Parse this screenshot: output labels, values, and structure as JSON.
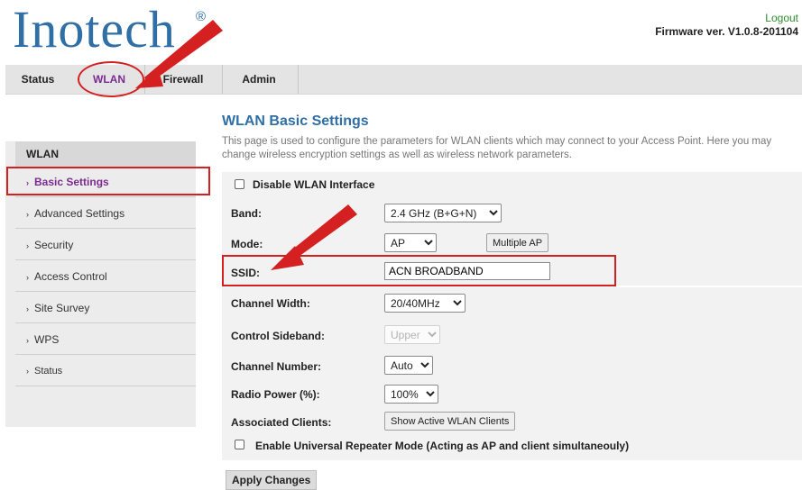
{
  "header": {
    "logo_text": "Inotech",
    "registered_mark": "®",
    "logout_label": "Logout",
    "firmware": "Firmware ver. V1.0.8-201104"
  },
  "nav": {
    "tabs": [
      {
        "label": "Status"
      },
      {
        "label": "WLAN"
      },
      {
        "label": "Firewall"
      },
      {
        "label": "Admin"
      }
    ],
    "active_color": "#7b2b8f"
  },
  "sidebar": {
    "heading": "WLAN",
    "items": [
      {
        "label": "Basic Settings"
      },
      {
        "label": "Advanced Settings"
      },
      {
        "label": "Security"
      },
      {
        "label": "Access Control"
      },
      {
        "label": "Site Survey"
      },
      {
        "label": "WPS"
      },
      {
        "label": "Status"
      }
    ],
    "chevron": "›"
  },
  "main": {
    "title": "WLAN Basic Settings",
    "description": "This page is used to configure the parameters for WLAN clients which may connect to your Access Point. Here you may change wireless encryption settings as well as wireless network parameters.",
    "disable_wlan_label": "Disable WLAN Interface",
    "band_label": "Band:",
    "band_value": "2.4 GHz (B+G+N)",
    "mode_label": "Mode:",
    "mode_value": "AP",
    "multiple_ap_label": "Multiple AP",
    "ssid_label": "SSID:",
    "ssid_value": "ACN BROADBAND",
    "channel_width_label": "Channel Width:",
    "channel_width_value": "20/40MHz",
    "control_sideband_label": "Control Sideband:",
    "control_sideband_value": "Upper",
    "channel_number_label": "Channel Number:",
    "channel_number_value": "Auto",
    "radio_power_label": "Radio Power (%):",
    "radio_power_value": "100%",
    "associated_clients_label": "Associated Clients:",
    "show_clients_label": "Show Active WLAN Clients",
    "repeater_label": "Enable Universal Repeater Mode (Acting as AP and client simultaneouly)",
    "apply_label": "Apply Changes"
  },
  "colors": {
    "brand": "#2f6fa6",
    "highlight": "#d42020",
    "logout": "#2e8b2e"
  }
}
